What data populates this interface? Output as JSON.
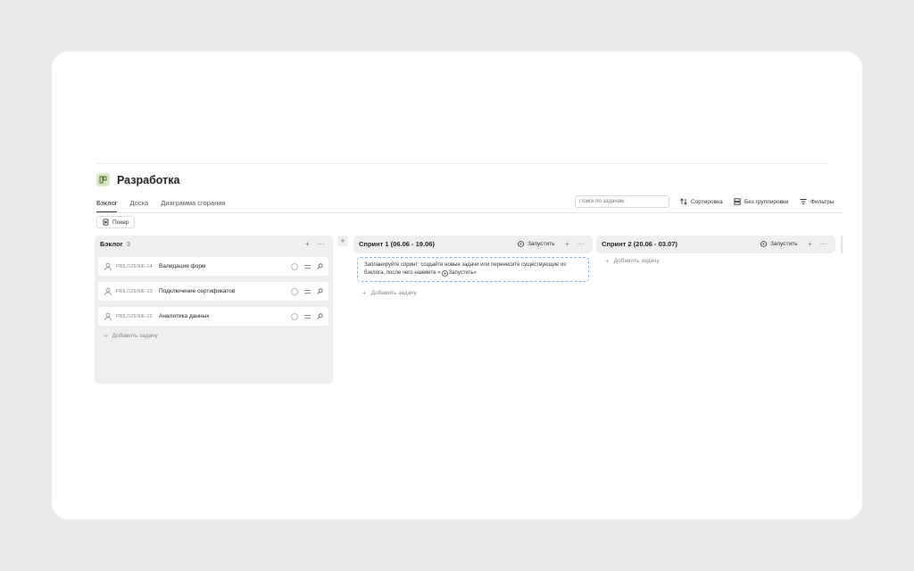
{
  "project": {
    "title": "Разработка",
    "icon": "project-icon"
  },
  "tabs": [
    {
      "label": "Бэклог",
      "active": true
    },
    {
      "label": "Доска",
      "active": false
    },
    {
      "label": "Диаграмма сгорания",
      "active": false
    }
  ],
  "toolbar": {
    "search_placeholder": "Поиск по задачам",
    "sort_label": "Сортировка",
    "group_label": "Без группировки",
    "filter_label": "Фильтры"
  },
  "poker": {
    "label": "Покер"
  },
  "backlog": {
    "title": "Бэклог",
    "count": "3",
    "tasks": [
      {
        "key": "PRILOZENIE-14",
        "name": "Валидация форм"
      },
      {
        "key": "PRILOZENIE-13",
        "name": "Подключение сертификатов"
      },
      {
        "key": "PRILOZENIE-12",
        "name": "Аналитика данных"
      }
    ],
    "add_label": "Добавить задачу"
  },
  "sprints": [
    {
      "title": "Спринт 1 (06.06 - 19.06)",
      "launch_label": "Запустить",
      "hint_line1": "Запланируйте спринт: создайте новые задачи или перенесите существующие из",
      "hint_line2_before": "бэклога, после чего нажмите «",
      "hint_line2_button": "Запустить",
      "hint_line2_after": "»",
      "add_label": "Добавить задачу"
    },
    {
      "title": "Спринт 2 (20.06 - 03.07)",
      "launch_label": "Запустить",
      "add_label": "Добавить задачу"
    }
  ],
  "symbols": {
    "plus": "+",
    "more": "···"
  }
}
